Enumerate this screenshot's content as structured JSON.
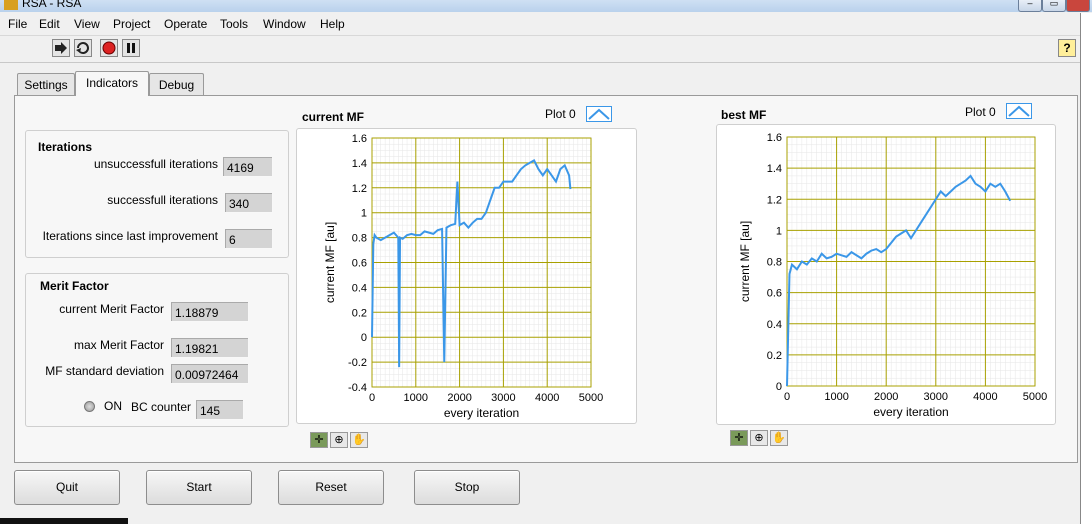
{
  "window": {
    "title": "RSA - RSA"
  },
  "menu": [
    "File",
    "Edit",
    "View",
    "Project",
    "Operate",
    "Tools",
    "Window",
    "Help"
  ],
  "toolbar": {
    "run_icon": "run-arrow-icon",
    "run_continuously_icon": "run-continuously-icon",
    "abort_icon": "abort-stop-icon",
    "pause_icon": "pause-icon",
    "help_label": "?"
  },
  "tabs": [
    {
      "label": "Settings",
      "active": false
    },
    {
      "label": "Indicators",
      "active": true
    },
    {
      "label": "Debug",
      "active": false
    }
  ],
  "iterations": {
    "title": "Iterations",
    "unsuccessful_label": "unsuccessfull iterations",
    "unsuccessful_value": "4169",
    "successful_label": "successfull iterations",
    "successful_value": "340",
    "since_improvement_label": "Iterations since last improvement",
    "since_improvement_value": "6"
  },
  "merit": {
    "title": "Merit Factor",
    "current_label": "current Merit Factor",
    "current_value": "1.18879",
    "max_label": "max Merit Factor",
    "max_value": "1.19821",
    "std_label": "MF standard deviation",
    "std_value": "0.00972464",
    "on_label": "ON",
    "bc_label": "BC counter",
    "bc_value": "145"
  },
  "buttons": {
    "quit": "Quit",
    "start": "Start",
    "reset": "Reset",
    "stop": "Stop"
  },
  "colors": {
    "plot_line": "#3b97e8",
    "grid": "#a8a000",
    "minor_grid": "#e6e6e6"
  },
  "chart_data": [
    {
      "type": "line",
      "title": "current MF",
      "legend": "Plot 0",
      "xlabel": "every iteration",
      "ylabel": "current MF [au]",
      "xlim": [
        0,
        5000
      ],
      "ylim": [
        -0.4,
        1.6
      ],
      "xticks": [
        "0",
        "1000",
        "2000",
        "3000",
        "4000",
        "5000"
      ],
      "yticks": [
        "-0.4",
        "-0.2",
        "0",
        "0.2",
        "0.4",
        "0.6",
        "0.8",
        "1",
        "1.2",
        "1.4",
        "1.6"
      ],
      "grid": true,
      "series": [
        {
          "name": "Plot 0",
          "x": [
            0,
            30,
            60,
            100,
            200,
            300,
            400,
            500,
            600,
            620,
            640,
            700,
            800,
            900,
            1000,
            1100,
            1200,
            1300,
            1400,
            1500,
            1600,
            1650,
            1700,
            1800,
            1900,
            1950,
            2000,
            2100,
            2200,
            2300,
            2400,
            2500,
            2600,
            2700,
            2800,
            2900,
            3000,
            3100,
            3200,
            3300,
            3400,
            3500,
            3600,
            3700,
            3800,
            3900,
            4000,
            4100,
            4200,
            4300,
            4400,
            4500,
            4530
          ],
          "y": [
            0.0,
            0.75,
            0.82,
            0.8,
            0.78,
            0.8,
            0.82,
            0.84,
            0.8,
            -0.24,
            0.8,
            0.79,
            0.82,
            0.83,
            0.82,
            0.82,
            0.85,
            0.84,
            0.83,
            0.86,
            0.87,
            -0.2,
            0.88,
            0.9,
            0.91,
            1.25,
            0.9,
            0.92,
            0.88,
            0.92,
            0.95,
            0.95,
            1.0,
            1.1,
            1.2,
            1.2,
            1.25,
            1.25,
            1.25,
            1.3,
            1.35,
            1.38,
            1.4,
            1.42,
            1.35,
            1.3,
            1.35,
            1.3,
            1.25,
            1.35,
            1.38,
            1.3,
            1.19
          ]
        }
      ]
    },
    {
      "type": "line",
      "title": "best MF",
      "legend": "Plot 0",
      "xlabel": "every iteration",
      "ylabel": "current MF [au]",
      "xlim": [
        0,
        5000
      ],
      "ylim": [
        0,
        1.6
      ],
      "xticks": [
        "0",
        "1000",
        "2000",
        "3000",
        "4000",
        "5000"
      ],
      "yticks": [
        "0",
        "0.2",
        "0.4",
        "0.6",
        "0.8",
        "1",
        "1.2",
        "1.4",
        "1.6"
      ],
      "grid": true,
      "series": [
        {
          "name": "Plot 0",
          "x": [
            0,
            50,
            100,
            200,
            300,
            400,
            500,
            600,
            700,
            800,
            900,
            1000,
            1100,
            1200,
            1300,
            1400,
            1500,
            1600,
            1700,
            1800,
            1900,
            2000,
            2100,
            2200,
            2300,
            2400,
            2500,
            2600,
            2700,
            2800,
            2900,
            3000,
            3100,
            3200,
            3300,
            3400,
            3500,
            3600,
            3700,
            3800,
            3900,
            4000,
            4100,
            4200,
            4300,
            4400,
            4500
          ],
          "y": [
            0.0,
            0.72,
            0.78,
            0.75,
            0.8,
            0.78,
            0.82,
            0.8,
            0.85,
            0.82,
            0.83,
            0.85,
            0.84,
            0.83,
            0.86,
            0.84,
            0.82,
            0.85,
            0.87,
            0.88,
            0.86,
            0.88,
            0.92,
            0.96,
            0.98,
            1.0,
            0.95,
            1.0,
            1.05,
            1.1,
            1.15,
            1.2,
            1.25,
            1.22,
            1.25,
            1.28,
            1.3,
            1.32,
            1.35,
            1.3,
            1.28,
            1.25,
            1.3,
            1.28,
            1.3,
            1.25,
            1.19
          ]
        }
      ]
    }
  ]
}
